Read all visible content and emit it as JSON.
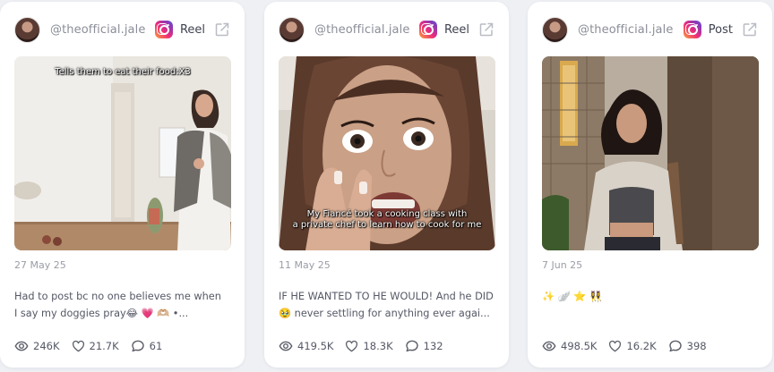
{
  "cards": [
    {
      "username": "@theofficial.jale",
      "platform_icon": "instagram-icon",
      "type": "Reel",
      "overlay": "Tells them to eat their food:X3",
      "date": "27 May 25",
      "caption_1": "Had to post bc no one believes me when",
      "caption_2": "I say my doggies pray😂 💗 🫶🏼 •...",
      "views": "246K",
      "likes": "21.7K",
      "comments": "61"
    },
    {
      "username": "@theofficial.jale",
      "platform_icon": "instagram-icon",
      "type": "Reel",
      "overlay_1": "My Fiancé took a cooking class with",
      "overlay_2": "a private chef to learn how to cook for me",
      "date": "11 May 25",
      "caption_1": "IF HE WANTED TO HE WOULD! And he DID",
      "caption_2": "🥹 never settling for anything ever agai...",
      "views": "419.5K",
      "likes": "18.3K",
      "comments": "132"
    },
    {
      "username": "@theofficial.jale",
      "platform_icon": "instagram-icon",
      "type": "Post",
      "date": "7 Jun 25",
      "caption_1": "✨ 🪽 ⭐ 👯‍♀️",
      "caption_2": "",
      "views": "498.5K",
      "likes": "16.2K",
      "comments": "398"
    }
  ],
  "colors": {
    "page_background": "#eef0f4",
    "card_background": "#ffffff",
    "muted_text": "#8b8e98",
    "body_text": "#555866"
  }
}
